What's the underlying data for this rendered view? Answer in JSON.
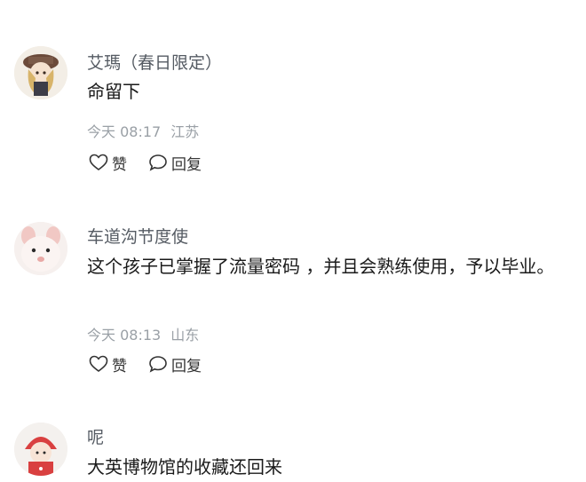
{
  "comments": [
    {
      "username": "艾瑪（春日限定）",
      "content": "命留下",
      "time": "今天 08:17",
      "location": "江苏",
      "like_label": "赞",
      "reply_label": "回复"
    },
    {
      "username": "车道沟节度使",
      "content": "这个孩子已掌握了流量密码 ，并且会熟练使用，予以毕业。",
      "time": "今天 08:13",
      "location": "山东",
      "like_label": "赞",
      "reply_label": "回复"
    },
    {
      "username": "呢",
      "content": "大英博物馆的收藏还回来"
    }
  ]
}
